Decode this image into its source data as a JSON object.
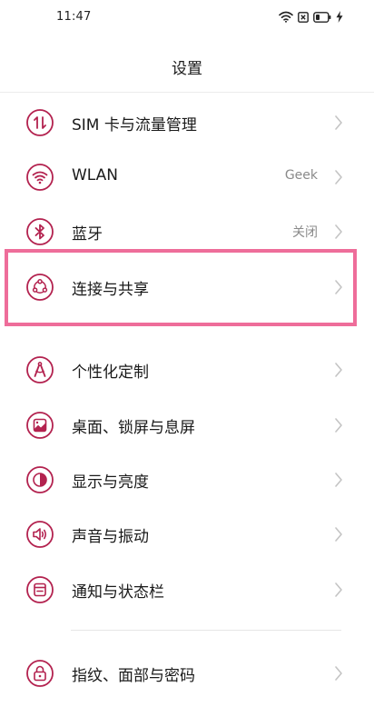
{
  "status_bar": {
    "time": "11:47",
    "icons": [
      "wifi-icon",
      "notification-x-icon",
      "battery-icon",
      "charging-bolt-icon"
    ]
  },
  "header": {
    "title": "设置"
  },
  "accent_color": "#b3224f",
  "highlight_color": "#ee6d9a",
  "settings": {
    "items": [
      {
        "label": "SIM 卡与流量管理",
        "value": "",
        "icon": "sim-data-icon"
      },
      {
        "label": "WLAN",
        "value": "Geek",
        "icon": "wifi-icon"
      },
      {
        "label": "蓝牙",
        "value": "关闭",
        "icon": "bluetooth-icon"
      },
      {
        "label": "连接与共享",
        "value": "",
        "icon": "connection-share-icon",
        "highlighted": true
      },
      {
        "label": "个性化定制",
        "value": "",
        "icon": "personalization-icon"
      },
      {
        "label": "桌面、锁屏与息屏",
        "value": "",
        "icon": "wallpaper-icon"
      },
      {
        "label": "显示与亮度",
        "value": "",
        "icon": "display-brightness-icon"
      },
      {
        "label": "声音与振动",
        "value": "",
        "icon": "sound-icon"
      },
      {
        "label": "通知与状态栏",
        "value": "",
        "icon": "notification-icon"
      },
      {
        "label": "指纹、面部与密码",
        "value": "",
        "icon": "lock-icon"
      }
    ]
  }
}
